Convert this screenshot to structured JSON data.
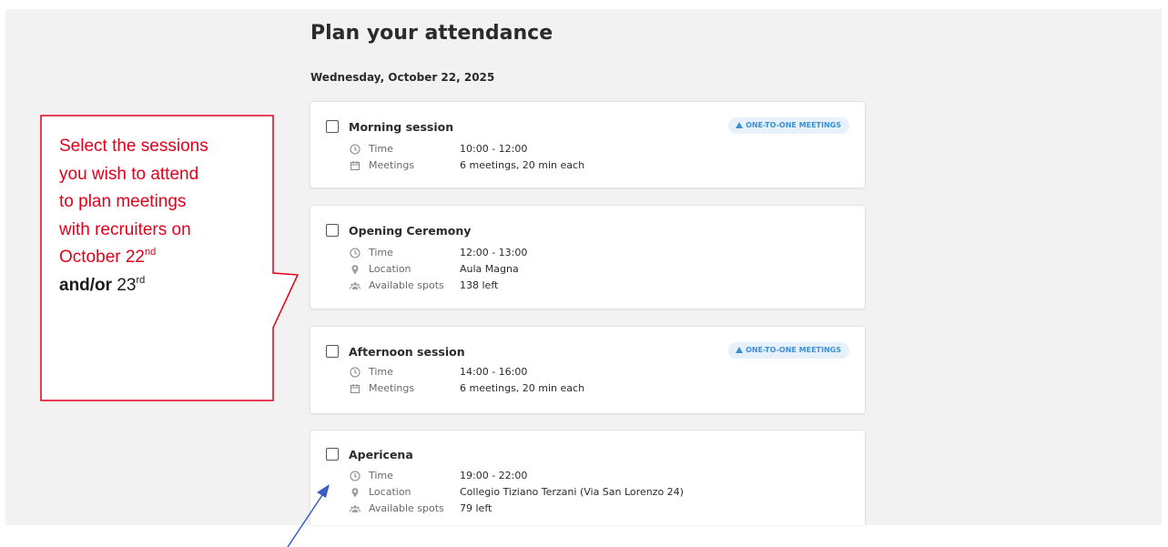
{
  "page": {
    "title": "Plan your attendance",
    "date": "Wednesday, October 22, 2025"
  },
  "sessions": [
    {
      "title": "Morning session",
      "badge": "ONE-TO-ONE MEETINGS",
      "details": [
        {
          "icon": "clock-icon",
          "label": "Time",
          "value": "10:00 - 12:00"
        },
        {
          "icon": "calendar-icon",
          "label": "Meetings",
          "value": "6 meetings, 20 min each"
        }
      ]
    },
    {
      "title": "Opening Ceremony",
      "badge": "",
      "details": [
        {
          "icon": "clock-icon",
          "label": "Time",
          "value": "12:00 - 13:00"
        },
        {
          "icon": "location-pin-icon",
          "label": "Location",
          "value": "Aula Magna"
        },
        {
          "icon": "people-icon",
          "label": "Available spots",
          "value": "138 left"
        }
      ]
    },
    {
      "title": "Afternoon session",
      "badge": "ONE-TO-ONE MEETINGS",
      "details": [
        {
          "icon": "clock-icon",
          "label": "Time",
          "value": "14:00 - 16:00"
        },
        {
          "icon": "calendar-icon",
          "label": "Meetings",
          "value": "6 meetings, 20 min each"
        }
      ]
    },
    {
      "title": "Apericena",
      "badge": "",
      "details": [
        {
          "icon": "clock-icon",
          "label": "Time",
          "value": "19:00 - 22:00"
        },
        {
          "icon": "location-pin-icon",
          "label": "Location",
          "value": "Collegio Tiziano Terzani (Via San Lorenzo 24)"
        },
        {
          "icon": "people-icon",
          "label": "Available spots",
          "value": "79 left"
        }
      ]
    }
  ],
  "callout": {
    "lines": [
      "Select the sessions",
      "you wish to attend",
      "to plan meetings",
      "with recruiters on"
    ],
    "date_line_text": "October 22",
    "date_line_sup": "nd",
    "last_bold": "and/or",
    "last_number": " 23",
    "last_sup": "rd"
  },
  "colors": {
    "callout": "#e3001b",
    "arrow": "#3b5ec6",
    "badge_text": "#3b8fd3",
    "badge_bg": "#e6f1fb"
  }
}
